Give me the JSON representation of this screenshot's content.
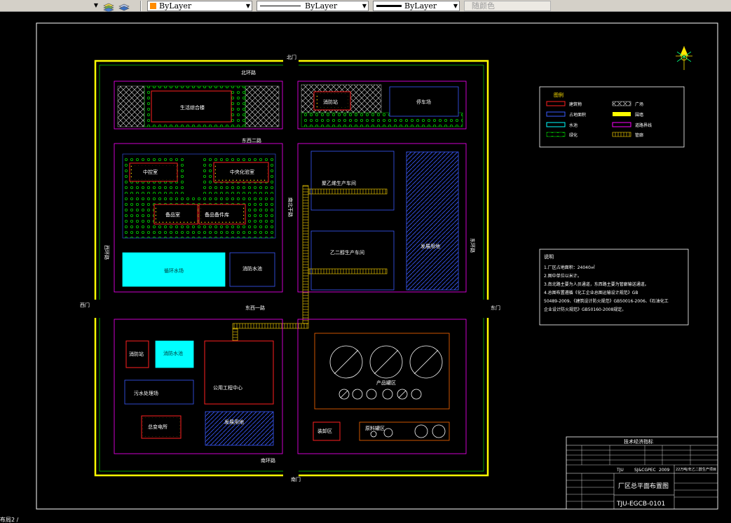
{
  "toolbar": {
    "color_combo": "ByLayer",
    "linetype_combo": "ByLayer",
    "lineweight_combo": "ByLayer",
    "plotstyle_combo": "随颜色",
    "color_swatch": "#ff8c00"
  },
  "drawing": {
    "gates": {
      "north": "北门",
      "south": "南门",
      "west": "西门",
      "east": "东门"
    },
    "roads": {
      "north_ring": "北环路",
      "east_west_2": "东西二路",
      "east_west_1": "东西一路",
      "south_ring": "南环路",
      "west_ring": "西环路",
      "east_ring": "东环路",
      "north_south": "南北干路"
    },
    "buildings": {
      "office": "生活综合楼",
      "canteen": "消防站",
      "parking": "停车场",
      "lab": "中控室",
      "control": "中央化验室",
      "storage": "备品室",
      "spare": "备品备件库",
      "pool": "循环水场",
      "sewage": "消防水池",
      "prod1": "聚乙烯生产车间",
      "prod2": "乙二醇生产车间",
      "reserve1": "发展用地",
      "firestation": "消防站",
      "firewater": "消防水池",
      "wastewater": "污水处理场",
      "utility": "公用工程中心",
      "substation": "总变电所",
      "reserve2": "发展用地",
      "tankfarm": "产品罐区",
      "loading": "装卸区",
      "raw_tank": "原料罐区"
    },
    "legend": {
      "title": "图例",
      "items": [
        "建筑物",
        "占地面积",
        "水池",
        "绿化",
        "广场",
        "围墙",
        "道路界线",
        "管廊"
      ]
    },
    "notes": {
      "title": "说明",
      "lines": [
        "1.厂区占地面积：24040㎡",
        "2.图中单位以米计。",
        "3.南北路主要为人员通道，东西路主要为管廊输送通道。",
        "4.总图布置遵循《化工企业总图运输设计规范》GB",
        "50489-2009、《建筑设计防火规范》GB50016-2006、《石油化工",
        "企业设计防火规范》GB50160-2008规定。"
      ]
    },
    "title_block": {
      "header": "技术经济指标",
      "school": "TJU",
      "code": "SJ&CGPEC",
      "year": "2009",
      "project": "22万吨/年乙二醇生产项目",
      "drawing_name": "厂区总平面布置图",
      "drawing_no": "TJU-EGCB-0101"
    },
    "status_tab": "布局2 /"
  }
}
